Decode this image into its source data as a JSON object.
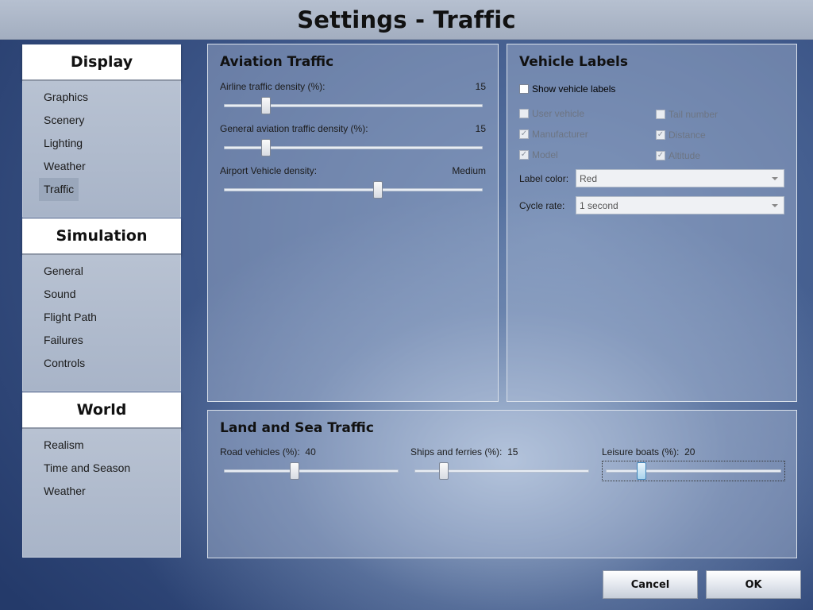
{
  "title": "Settings - Traffic",
  "sidebar": {
    "sections": [
      {
        "header": "Display",
        "items": [
          "Graphics",
          "Scenery",
          "Lighting",
          "Weather",
          "Traffic"
        ],
        "active": "Traffic"
      },
      {
        "header": "Simulation",
        "items": [
          "General",
          "Sound",
          "Flight Path",
          "Failures",
          "Controls"
        ]
      },
      {
        "header": "World",
        "items": [
          "Realism",
          "Time and Season",
          "Weather"
        ]
      }
    ]
  },
  "aviation": {
    "title": "Aviation Traffic",
    "airline": {
      "label": "Airline traffic density (%):",
      "value": "15",
      "fraction": 0.15
    },
    "general": {
      "label": "General aviation traffic density (%):",
      "value": "15",
      "fraction": 0.15
    },
    "vehicle": {
      "label": "Airport Vehicle density:",
      "value": "Medium",
      "fraction": 0.6
    }
  },
  "vehicle_labels": {
    "title": "Vehicle Labels",
    "show": {
      "label": "Show vehicle labels",
      "checked": false
    },
    "options": [
      {
        "label": "User vehicle",
        "checked": false
      },
      {
        "label": "Tail number",
        "checked": false
      },
      {
        "label": "Manufacturer",
        "checked": true
      },
      {
        "label": "Distance",
        "checked": true
      },
      {
        "label": "Model",
        "checked": true
      },
      {
        "label": "Altitude",
        "checked": true
      }
    ],
    "label_color": {
      "label": "Label color:",
      "value": "Red"
    },
    "cycle_rate": {
      "label": "Cycle rate:",
      "value": "1 second"
    }
  },
  "land_sea": {
    "title": "Land and Sea Traffic",
    "road": {
      "label": "Road vehicles (%):",
      "value": "40",
      "fraction": 0.4
    },
    "ships": {
      "label": "Ships and ferries (%):",
      "value": "15",
      "fraction": 0.15
    },
    "leisure": {
      "label": "Leisure boats (%):",
      "value": "20",
      "fraction": 0.2
    }
  },
  "buttons": {
    "cancel": "Cancel",
    "ok": "OK"
  },
  "icons": {
    "checkmark": "check-icon",
    "dropdown": "chevron-down-icon"
  }
}
